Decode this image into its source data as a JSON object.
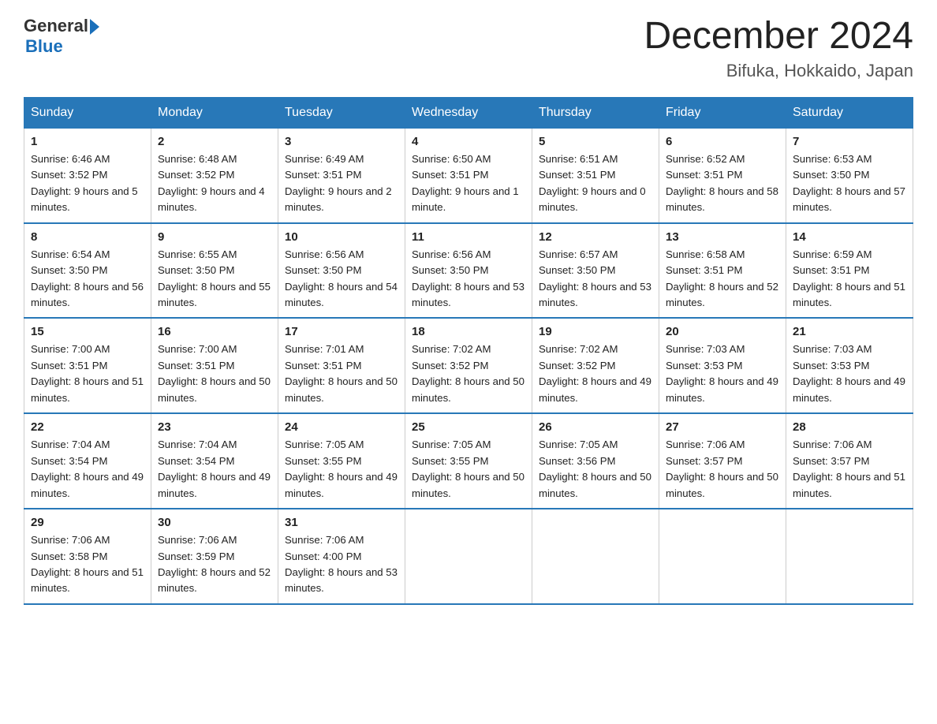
{
  "header": {
    "logo_general": "General",
    "logo_blue": "Blue",
    "title": "December 2024",
    "subtitle": "Bifuka, Hokkaido, Japan"
  },
  "days_of_week": [
    "Sunday",
    "Monday",
    "Tuesday",
    "Wednesday",
    "Thursday",
    "Friday",
    "Saturday"
  ],
  "weeks": [
    [
      {
        "day": "1",
        "sunrise": "6:46 AM",
        "sunset": "3:52 PM",
        "daylight": "9 hours and 5 minutes."
      },
      {
        "day": "2",
        "sunrise": "6:48 AM",
        "sunset": "3:52 PM",
        "daylight": "9 hours and 4 minutes."
      },
      {
        "day": "3",
        "sunrise": "6:49 AM",
        "sunset": "3:51 PM",
        "daylight": "9 hours and 2 minutes."
      },
      {
        "day": "4",
        "sunrise": "6:50 AM",
        "sunset": "3:51 PM",
        "daylight": "9 hours and 1 minute."
      },
      {
        "day": "5",
        "sunrise": "6:51 AM",
        "sunset": "3:51 PM",
        "daylight": "9 hours and 0 minutes."
      },
      {
        "day": "6",
        "sunrise": "6:52 AM",
        "sunset": "3:51 PM",
        "daylight": "8 hours and 58 minutes."
      },
      {
        "day": "7",
        "sunrise": "6:53 AM",
        "sunset": "3:50 PM",
        "daylight": "8 hours and 57 minutes."
      }
    ],
    [
      {
        "day": "8",
        "sunrise": "6:54 AM",
        "sunset": "3:50 PM",
        "daylight": "8 hours and 56 minutes."
      },
      {
        "day": "9",
        "sunrise": "6:55 AM",
        "sunset": "3:50 PM",
        "daylight": "8 hours and 55 minutes."
      },
      {
        "day": "10",
        "sunrise": "6:56 AM",
        "sunset": "3:50 PM",
        "daylight": "8 hours and 54 minutes."
      },
      {
        "day": "11",
        "sunrise": "6:56 AM",
        "sunset": "3:50 PM",
        "daylight": "8 hours and 53 minutes."
      },
      {
        "day": "12",
        "sunrise": "6:57 AM",
        "sunset": "3:50 PM",
        "daylight": "8 hours and 53 minutes."
      },
      {
        "day": "13",
        "sunrise": "6:58 AM",
        "sunset": "3:51 PM",
        "daylight": "8 hours and 52 minutes."
      },
      {
        "day": "14",
        "sunrise": "6:59 AM",
        "sunset": "3:51 PM",
        "daylight": "8 hours and 51 minutes."
      }
    ],
    [
      {
        "day": "15",
        "sunrise": "7:00 AM",
        "sunset": "3:51 PM",
        "daylight": "8 hours and 51 minutes."
      },
      {
        "day": "16",
        "sunrise": "7:00 AM",
        "sunset": "3:51 PM",
        "daylight": "8 hours and 50 minutes."
      },
      {
        "day": "17",
        "sunrise": "7:01 AM",
        "sunset": "3:51 PM",
        "daylight": "8 hours and 50 minutes."
      },
      {
        "day": "18",
        "sunrise": "7:02 AM",
        "sunset": "3:52 PM",
        "daylight": "8 hours and 50 minutes."
      },
      {
        "day": "19",
        "sunrise": "7:02 AM",
        "sunset": "3:52 PM",
        "daylight": "8 hours and 49 minutes."
      },
      {
        "day": "20",
        "sunrise": "7:03 AM",
        "sunset": "3:53 PM",
        "daylight": "8 hours and 49 minutes."
      },
      {
        "day": "21",
        "sunrise": "7:03 AM",
        "sunset": "3:53 PM",
        "daylight": "8 hours and 49 minutes."
      }
    ],
    [
      {
        "day": "22",
        "sunrise": "7:04 AM",
        "sunset": "3:54 PM",
        "daylight": "8 hours and 49 minutes."
      },
      {
        "day": "23",
        "sunrise": "7:04 AM",
        "sunset": "3:54 PM",
        "daylight": "8 hours and 49 minutes."
      },
      {
        "day": "24",
        "sunrise": "7:05 AM",
        "sunset": "3:55 PM",
        "daylight": "8 hours and 49 minutes."
      },
      {
        "day": "25",
        "sunrise": "7:05 AM",
        "sunset": "3:55 PM",
        "daylight": "8 hours and 50 minutes."
      },
      {
        "day": "26",
        "sunrise": "7:05 AM",
        "sunset": "3:56 PM",
        "daylight": "8 hours and 50 minutes."
      },
      {
        "day": "27",
        "sunrise": "7:06 AM",
        "sunset": "3:57 PM",
        "daylight": "8 hours and 50 minutes."
      },
      {
        "day": "28",
        "sunrise": "7:06 AM",
        "sunset": "3:57 PM",
        "daylight": "8 hours and 51 minutes."
      }
    ],
    [
      {
        "day": "29",
        "sunrise": "7:06 AM",
        "sunset": "3:58 PM",
        "daylight": "8 hours and 51 minutes."
      },
      {
        "day": "30",
        "sunrise": "7:06 AM",
        "sunset": "3:59 PM",
        "daylight": "8 hours and 52 minutes."
      },
      {
        "day": "31",
        "sunrise": "7:06 AM",
        "sunset": "4:00 PM",
        "daylight": "8 hours and 53 minutes."
      },
      null,
      null,
      null,
      null
    ]
  ]
}
